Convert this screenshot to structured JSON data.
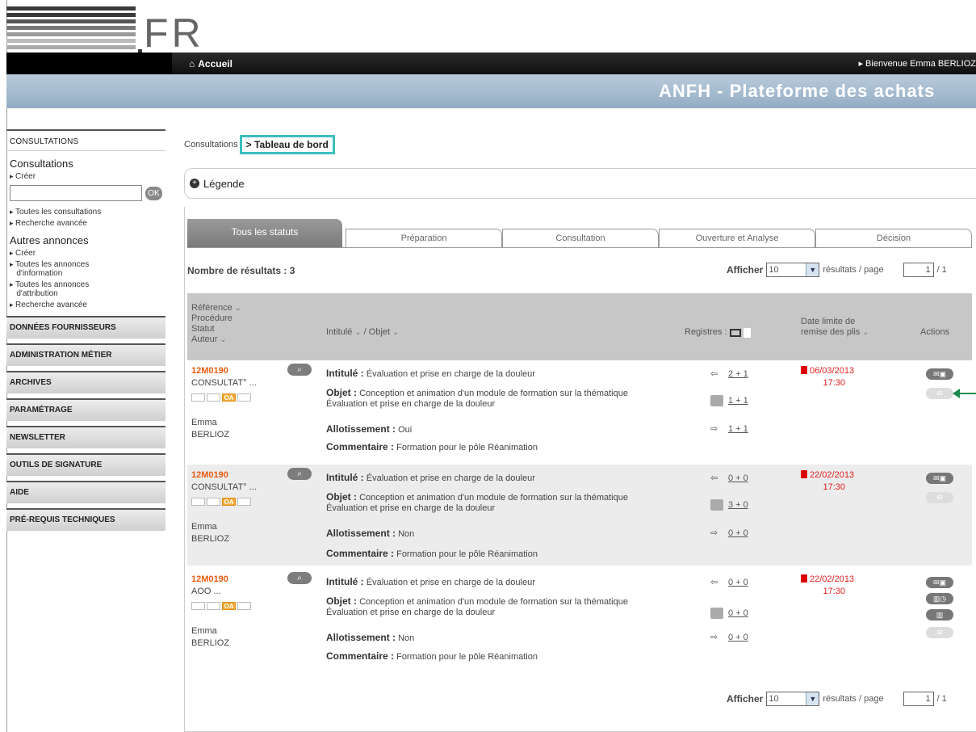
{
  "header": {
    "logo_text": "ANFH",
    "logo_suffix": "FR",
    "nav_home": "Accueil",
    "welcome": "Bienvenue Emma BERLIOZ",
    "banner_title": "ANFH - Plateforme des achats"
  },
  "sidebar": {
    "section_title": "CONSULTATIONS",
    "consultations_heading": "Consultations",
    "create_link": "Créer",
    "search_value": "",
    "ok_label": "OK",
    "all_consultations": "Toutes les consultations",
    "advanced_search": "Recherche avancée",
    "other_heading": "Autres annonces",
    "other_create": "Créer",
    "info_announces_1": "Toutes les annonces",
    "info_announces_2": "d'information",
    "attrib_announces_1": "Toutes les annonces",
    "attrib_announces_2": "d'attribution",
    "other_advanced": "Recherche avancée",
    "menu": [
      "DONNÉES FOURNISSEURS",
      "ADMINISTRATION MÉTIER",
      "ARCHIVES",
      "PARAMÉTRAGE",
      "NEWSLETTER",
      "OUTILS DE SIGNATURE",
      "AIDE",
      "PRÉ-REQUIS TECHNIQUES"
    ]
  },
  "breadcrumb": {
    "parent": "Consultations",
    "separator": ">",
    "current": "Tableau de bord"
  },
  "legend": {
    "label": "Légende"
  },
  "tabs": [
    {
      "label": "Tous les statuts",
      "active": true
    },
    {
      "label": "Préparation",
      "active": false
    },
    {
      "label": "Consultation",
      "active": false
    },
    {
      "label": "Ouverture et Analyse",
      "active": false
    },
    {
      "label": "Décision",
      "active": false
    }
  ],
  "results": {
    "count_label": "Nombre de résultats : 3",
    "show_label": "Afficher",
    "per_page_value": "10",
    "per_page_label": "résultats / page",
    "page_value": "1",
    "page_total": "/ 1"
  },
  "table_header": {
    "col1": [
      "Référence",
      "Procédure",
      "Statut",
      "Auteur"
    ],
    "col2": "Intitulé",
    "col2b": "/ Objet",
    "col3": "Registres :",
    "col4a": "Date limite de",
    "col4b": "remise des plis",
    "col5": "Actions"
  },
  "rows": [
    {
      "ref": "12M0190",
      "procedure": "CONSULTAT° ...",
      "author_first": "Emma",
      "author_last": "BERLIOZ",
      "intitule_label": "Intitulé :",
      "intitule": "Évaluation et prise en charge de la douleur",
      "objet_label": "Objet :",
      "objet1": "Conception et animation d'un module de formation sur la thématique",
      "objet2": "Évaluation et prise en charge de la douleur",
      "allot_label": "Allotissement :",
      "allot": "Oui",
      "comment_label": "Commentaire :",
      "comment": "Formation pour le pôle Réanimation",
      "reg1": "2 + 1",
      "reg2": "1 + 1",
      "reg3": "1 + 1",
      "date": "06/03/2013",
      "time": "17:30",
      "status_badge": "OA"
    },
    {
      "ref": "12M0190",
      "procedure": "CONSULTAT° ...",
      "author_first": "Emma",
      "author_last": "BERLIOZ",
      "intitule_label": "Intitulé :",
      "intitule": "Évaluation et prise en charge de la douleur",
      "objet_label": "Objet :",
      "objet1": "Conception et animation d'un module de formation sur la thématique",
      "objet2": "Évaluation et prise en charge de la douleur",
      "allot_label": "Allotissement :",
      "allot": "Non",
      "comment_label": "Commentaire :",
      "comment": "Formation pour le pôle Réanimation",
      "reg1": "0 + 0",
      "reg2": "3 + 0",
      "reg3": "0 + 0",
      "date": "22/02/2013",
      "time": "17:30",
      "status_badge": "OA"
    },
    {
      "ref": "12M0190",
      "procedure": "AOO ...",
      "author_first": "Emma",
      "author_last": "BERLIOZ",
      "intitule_label": "Intitulé :",
      "intitule": "Évaluation et prise en charge de la douleur",
      "objet_label": "Objet :",
      "objet1": "Conception et animation d'un module de formation sur la thématique",
      "objet2": "Évaluation et prise en charge de la douleur",
      "allot_label": "Allotissement :",
      "allot": "Non",
      "comment_label": "Commentaire :",
      "comment": "Formation pour le pôle Réanimation",
      "reg1": "0 + 0",
      "reg2": "0 + 0",
      "reg3": "0 + 0",
      "date": "22/02/2013",
      "time": "17:30",
      "status_badge": "OA"
    }
  ],
  "colors": {
    "accent_orange": "#e85c12",
    "date_red": "#e02020",
    "highlight_teal": "#3bbfbf",
    "arrow_green": "#1c8a4e",
    "banner_blue": "#a7bdd2"
  }
}
